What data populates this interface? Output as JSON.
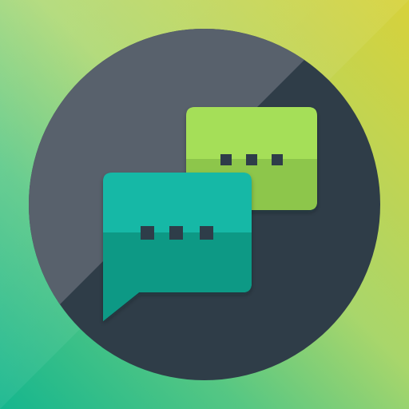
{
  "icon": {
    "semantic": "chat-bubbles-app-icon",
    "colors": {
      "background_top": "#d8d252",
      "background_mid": "#9fd26d",
      "background_bottom": "#19b38f",
      "circle_dark": "#2e3b47",
      "circle_light": "#56626c",
      "bubble_green_top": "#a5df58",
      "bubble_green_bottom": "#8dc64c",
      "bubble_teal_top": "#14b8a6",
      "bubble_teal_bottom": "#079985",
      "dots": "#2e3b47"
    },
    "elements": {
      "back_bubble": "green-chat-bubble",
      "front_bubble": "teal-chat-bubble-with-tail",
      "dots": "typing-dots"
    }
  }
}
